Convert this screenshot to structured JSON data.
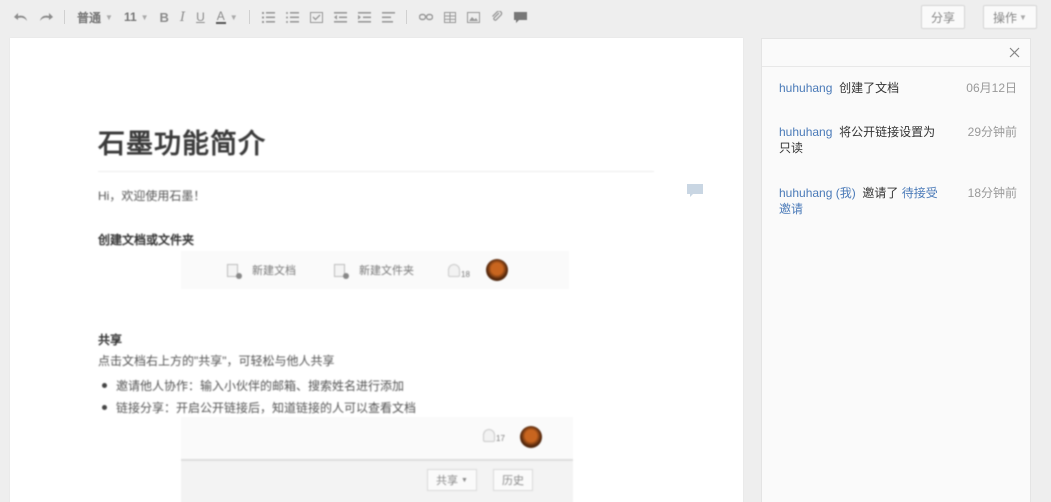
{
  "toolbar": {
    "paragraph_style": "普通",
    "font_size": "11",
    "share_label": "分享",
    "actions_label": "操作"
  },
  "document": {
    "title": "石墨功能简介",
    "greeting": "Hi，欢迎使用石墨！",
    "section1_heading": "创建文档或文件夹",
    "new_doc": "新建文档",
    "new_folder": "新建文件夹",
    "notify_count": "18",
    "section2_heading": "共享",
    "section2_intro": "点击文档右上方的\"共享\"，可轻松与他人共享",
    "bullets": [
      "邀请他人协作：输入小伙伴的邮箱、搜索姓名进行添加",
      "链接分享：开启公开链接后，知道链接的人可以查看文档"
    ],
    "notify_count2": "17",
    "share_button": "共享",
    "history_button": "历史"
  },
  "activity": [
    {
      "user": "huhuhang",
      "text": "创建了文档",
      "link": "",
      "time": "06月12日"
    },
    {
      "user": "huhuhang",
      "text": "将公开链接设置为只读",
      "link": "",
      "time": "29分钟前"
    },
    {
      "user": "huhuhang (我)",
      "text": "邀请了 ",
      "link": "待接受邀请",
      "time": "18分钟前"
    }
  ],
  "colors": {
    "accent": "#4a7ab8",
    "background": "#eeeeee",
    "panel": "#fafafa"
  }
}
